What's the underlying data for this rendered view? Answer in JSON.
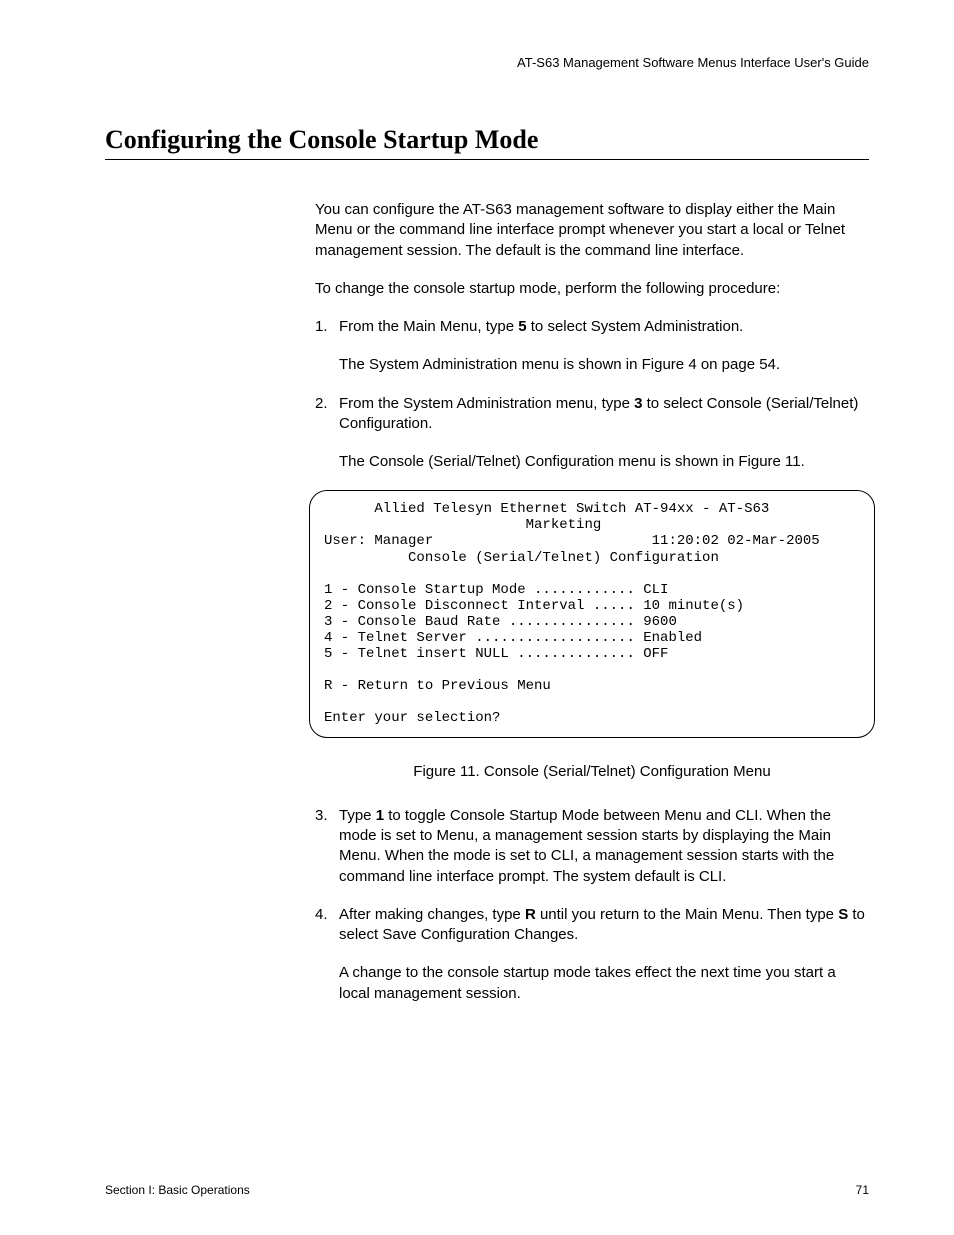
{
  "header": {
    "guide_title": "AT-S63 Management Software Menus Interface User's Guide"
  },
  "heading": "Configuring the Console Startup Mode",
  "intro": {
    "p1": "You can configure the AT-S63 management software to display either the Main Menu or the command line interface prompt whenever you start a local or Telnet management session. The default is the command line interface.",
    "p2": "To change the console startup mode, perform the following procedure:"
  },
  "steps": {
    "s1": {
      "num": "1.",
      "pre": "From the Main Menu, type ",
      "key": "5",
      "post": " to select System Administration.",
      "follow": "The System Administration menu is shown in Figure 4 on page 54."
    },
    "s2": {
      "num": "2.",
      "pre": "From the System Administration menu, type ",
      "key": "3",
      "post": " to select Console (Serial/Telnet) Configuration.",
      "follow": "The Console (Serial/Telnet) Configuration menu is shown in Figure 11."
    },
    "s3": {
      "num": "3.",
      "pre": "Type ",
      "key": "1",
      "post": " to toggle Console Startup Mode between Menu and CLI. When the mode is set to Menu, a management session starts by displaying the Main Menu. When the mode is set to CLI, a management session starts with the command line interface prompt. The system default is CLI."
    },
    "s4": {
      "num": "4.",
      "pre": "After making changes, type ",
      "key1": "R",
      "mid": " until you return to the Main Menu. Then type ",
      "key2": "S",
      "post": " to select Save Configuration Changes.",
      "follow": "A change to the console startup mode takes effect the next time you start a local management session."
    }
  },
  "terminal": {
    "line1": "      Allied Telesyn Ethernet Switch AT-94xx - AT-S63",
    "line2": "                        Marketing",
    "line3": "User: Manager                          11:20:02 02-Mar-2005",
    "line4": "          Console (Serial/Telnet) Configuration",
    "line5": "",
    "line6": "1 - Console Startup Mode ............ CLI",
    "line7": "2 - Console Disconnect Interval ..... 10 minute(s)",
    "line8": "3 - Console Baud Rate ............... 9600",
    "line9": "4 - Telnet Server ................... Enabled",
    "line10": "5 - Telnet insert NULL .............. OFF",
    "line11": "",
    "line12": "R - Return to Previous Menu",
    "line13": "",
    "line14": "Enter your selection?"
  },
  "figure_caption": "Figure 11. Console (Serial/Telnet) Configuration Menu",
  "footer": {
    "section": "Section I: Basic Operations",
    "page": "71"
  }
}
